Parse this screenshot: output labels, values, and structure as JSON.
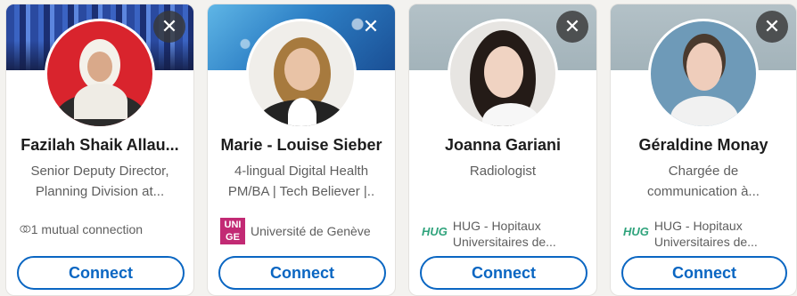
{
  "cards": [
    {
      "name": "Fazilah Shaik Allau...",
      "headline_1": "Senior Deputy Director,",
      "headline_2": "Planning Division at...",
      "insight_icon": "mutual-connections-icon",
      "insight_line_1": "1 mutual connection",
      "insight_line_2": "",
      "close_glyph": "✕",
      "connect_label": "Connect"
    },
    {
      "name": "Marie - Louise Sieber",
      "headline_1": "4-lingual Digital Health",
      "headline_2": "PM/BA | Tech Believer |..",
      "insight_icon": "unige-logo",
      "logo_text_1": "UNI",
      "logo_text_2": "GE",
      "insight_line_1": "Université de Genève",
      "insight_line_2": "",
      "close_glyph": "✕",
      "connect_label": "Connect"
    },
    {
      "name": "Joanna Gariani",
      "headline_1": "Radiologist",
      "headline_2": "",
      "insight_icon": "hug-logo",
      "logo_text_1": "HUG",
      "insight_line_1": "HUG - Hopitaux",
      "insight_line_2": "Universitaires de...",
      "close_glyph": "✕",
      "connect_label": "Connect"
    },
    {
      "name": "Géraldine Monay",
      "headline_1": "Chargée de",
      "headline_2": "communication à...",
      "insight_icon": "hug-logo",
      "logo_text_1": "HUG",
      "insight_line_1": "HUG - Hopitaux",
      "insight_line_2": "Universitaires de...",
      "close_glyph": "✕",
      "connect_label": "Connect"
    }
  ],
  "colors": {
    "accent": "#0a66c2",
    "hug_green": "#2fa37c",
    "unige_magenta": "#c22a74"
  }
}
